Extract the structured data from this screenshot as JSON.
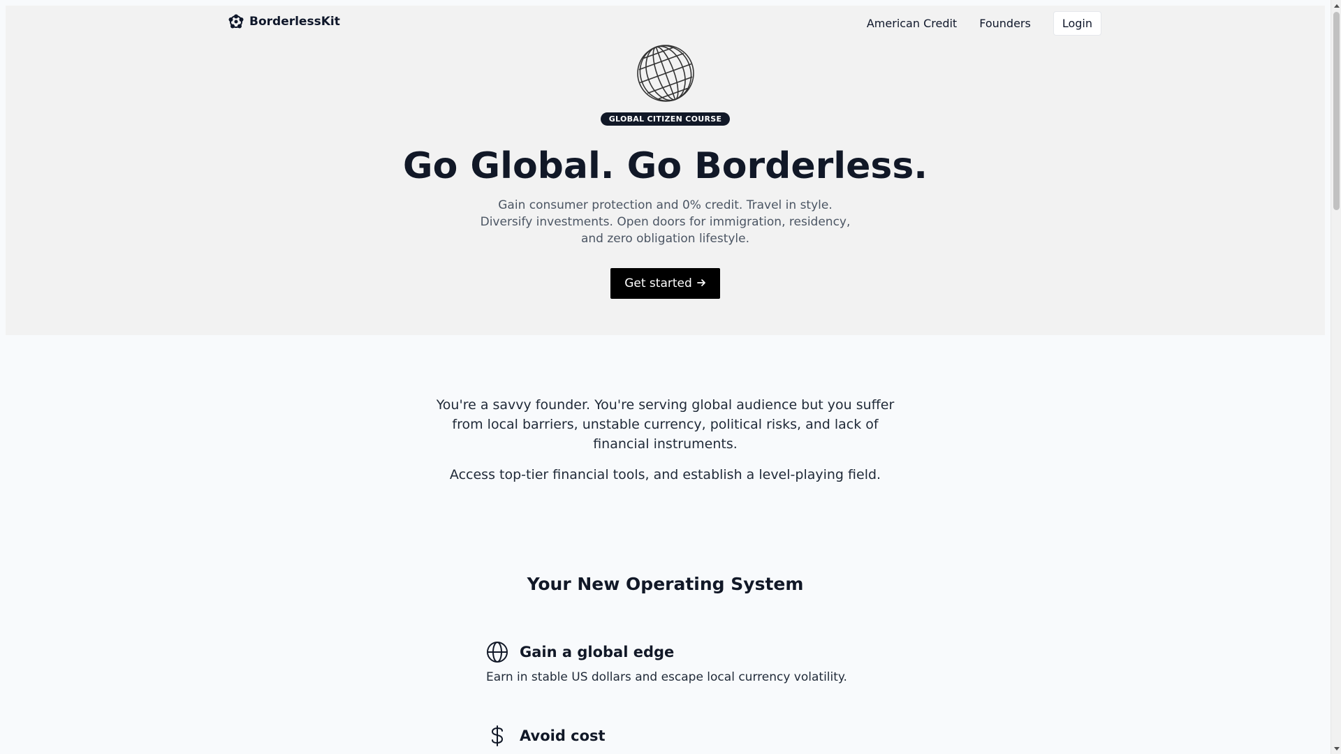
{
  "nav": {
    "brand": "BorderlessKit",
    "links": [
      "American Credit",
      "Founders"
    ],
    "login": "Login"
  },
  "hero": {
    "badge": "GLOBAL CITIZEN COURSE",
    "title": "Go Global. Go Borderless.",
    "subtitle": "Gain consumer protection and 0% credit. Travel in style. Diversify investments. Open doors for immigration, residency, and zero obligation lifestyle.",
    "cta": "Get started",
    "cta_icon": "arrow-right-icon"
  },
  "intro": {
    "p1": "You're a savvy founder. You're serving global audience but you suffer from local barriers, unstable currency, political risks, and lack of financial instruments.",
    "p2": "Access top-tier financial tools, and establish a level-playing field."
  },
  "os": {
    "title": "Your New Operating System",
    "features": [
      {
        "icon": "globe-icon",
        "title": "Gain a global edge",
        "desc": "Earn in stable US dollars and escape local currency volatility."
      },
      {
        "icon": "dollar-icon",
        "title": "Avoid cost",
        "desc": ""
      }
    ]
  },
  "colors": {
    "hero_bg": "#f2f2f2",
    "page_bg": "#f8fafc",
    "badge_bg": "#111827",
    "cta_bg": "#000000"
  }
}
